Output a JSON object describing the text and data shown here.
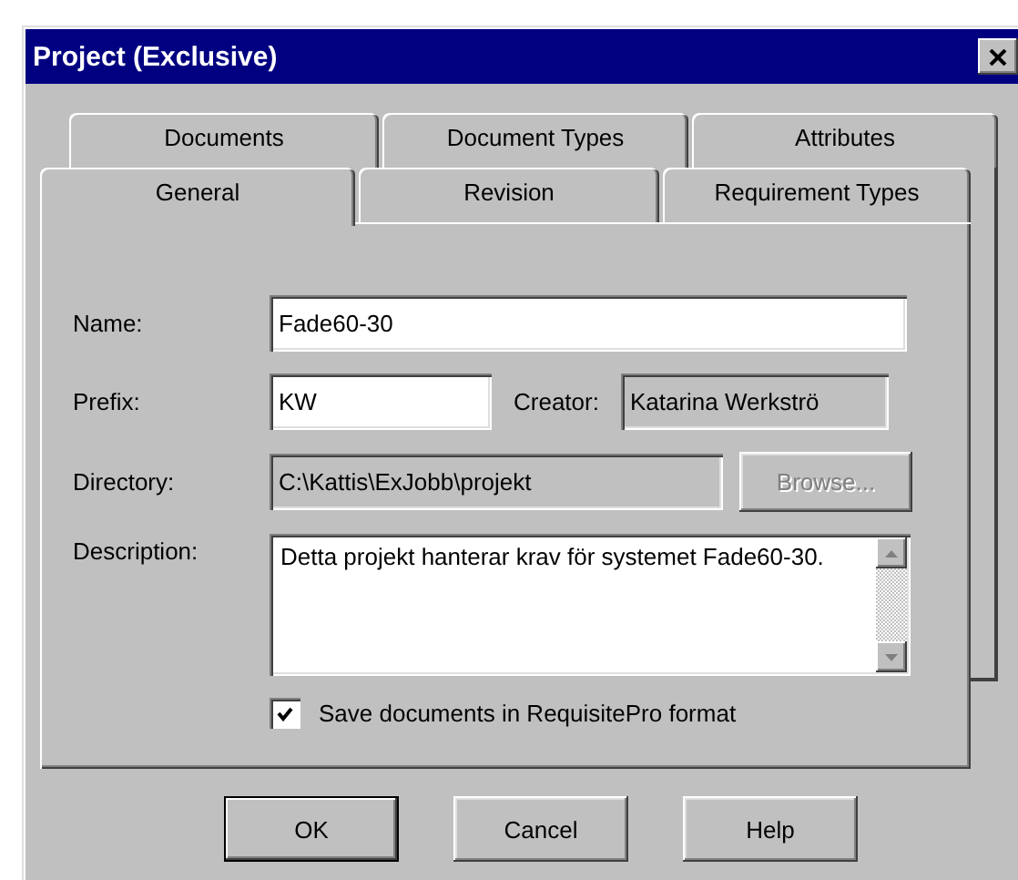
{
  "window": {
    "title": "Project (Exclusive)"
  },
  "tab_rows": [
    [
      {
        "label": "Documents",
        "selected": false
      },
      {
        "label": "Document Types",
        "selected": false
      },
      {
        "label": "Attributes",
        "selected": false
      }
    ],
    [
      {
        "label": "General",
        "selected": true
      },
      {
        "label": "Revision",
        "selected": false
      },
      {
        "label": "Requirement Types",
        "selected": false
      }
    ]
  ],
  "fields": {
    "name": {
      "label": "Name:",
      "value": "Fade60-30",
      "disabled": false
    },
    "prefix": {
      "label": "Prefix:",
      "value": "KW",
      "disabled": false
    },
    "creator": {
      "label": "Creator:",
      "value": "Katarina Werkströ",
      "disabled": true
    },
    "directory": {
      "label": "Directory:",
      "value": "C:\\Kattis\\ExJobb\\projekt",
      "disabled": true
    },
    "browse": {
      "label": "Browse...",
      "disabled": true
    },
    "description": {
      "label": "Description:",
      "value": "Detta projekt hanterar krav för systemet Fade60-30.",
      "disabled": false
    }
  },
  "save_checkbox": {
    "label": "Save documents in RequisitePro format",
    "checked": true
  },
  "buttons": [
    {
      "label": "OK",
      "default": true
    },
    {
      "label": "Cancel",
      "default": false
    },
    {
      "label": "Help",
      "default": false
    }
  ]
}
